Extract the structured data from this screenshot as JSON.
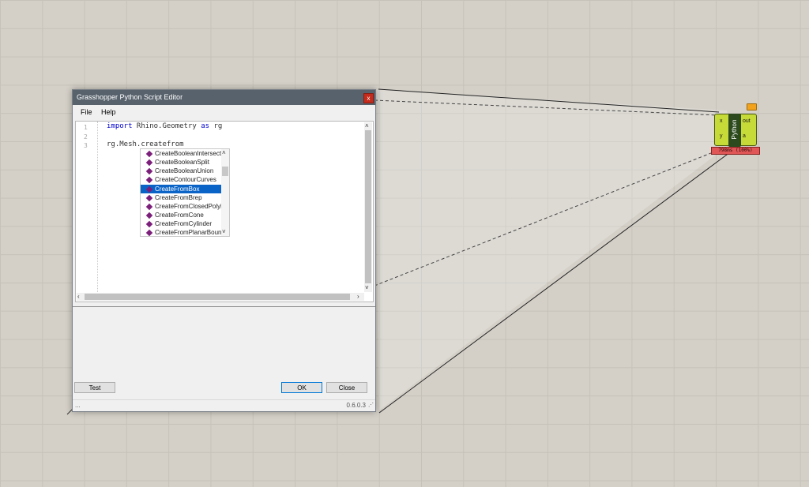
{
  "editor": {
    "title": "Grasshopper Python Script Editor",
    "close_label": "x",
    "menu": [
      "File",
      "Help"
    ],
    "line_numbers": [
      "1",
      "2",
      "3"
    ],
    "code": {
      "line1_kw_import": "import",
      "line1_mid": " Rhino.Geometry ",
      "line1_kw_as": "as",
      "line1_tail": " rg",
      "line3": "rg.Mesh.createfrom"
    },
    "autocomplete": {
      "items": [
        "CreateBooleanIntersection",
        "CreateBooleanSplit",
        "CreateBooleanUnion",
        "CreateContourCurves",
        "CreateFromBox",
        "CreateFromBrep",
        "CreateFromClosedPolyline",
        "CreateFromCone",
        "CreateFromCylinder",
        "CreateFromPlanarBoundary"
      ],
      "selected": "CreateFromBox"
    },
    "buttons": {
      "test": "Test",
      "ok": "OK",
      "close": "Close"
    },
    "status_left": "...",
    "version": "0.6.0.3"
  },
  "component": {
    "name": "Python",
    "inputs": [
      "x",
      "y"
    ],
    "outputs": [
      "out",
      "a"
    ],
    "status": "798ms (100%)"
  }
}
